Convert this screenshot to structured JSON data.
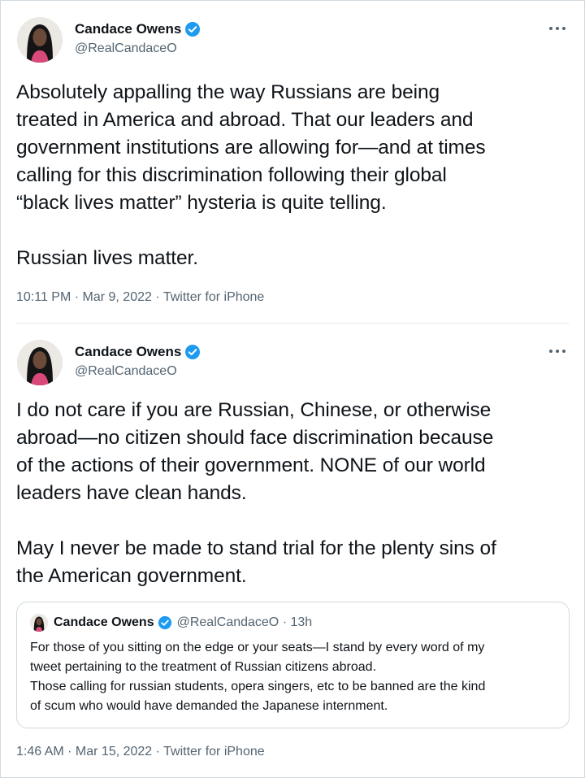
{
  "tweets": [
    {
      "author": {
        "name": "Candace Owens",
        "handle": "@RealCandaceO",
        "verified": true
      },
      "text": "Absolutely appalling the way Russians are being\ntreated in America and abroad. That our leaders and\ngovernment institutions are allowing for—and at times\ncalling for this discrimination following their global\n“black lives matter” hysteria is quite telling.\n\nRussian lives matter.",
      "timestamp": "10:11 PM · Mar 9, 2022 · Twitter for iPhone"
    },
    {
      "author": {
        "name": "Candace Owens",
        "handle": "@RealCandaceO",
        "verified": true
      },
      "text": "I do not care if you are Russian, Chinese, or otherwise\nabroad—no citizen should face discrimination because\nof the actions of their government. NONE of our world\nleaders have clean hands.\n\nMay I never be made to stand trial for the plenty sins of\nthe American government.",
      "quoted_tweet": {
        "author": {
          "name": "Candace Owens",
          "handle": "@RealCandaceO · 13h",
          "verified": true
        },
        "text": "For those of you sitting on the edge or your seats—I stand by every word of my\ntweet pertaining to the treatment of Russian citizens abroad.\nThose calling for russian students, opera singers, etc to be banned are the kind\nof scum who would have demanded the Japanese internment."
      },
      "timestamp": "1:46 AM · Mar 15, 2022 · Twitter for iPhone"
    }
  ],
  "icons": {
    "verified": "verified-badge-icon",
    "more": "more-options-icon",
    "avatar": "profile-photo"
  },
  "colors": {
    "verified_blue": "#1d9bf0",
    "secondary_text": "#536471",
    "border": "#cfd9de"
  }
}
